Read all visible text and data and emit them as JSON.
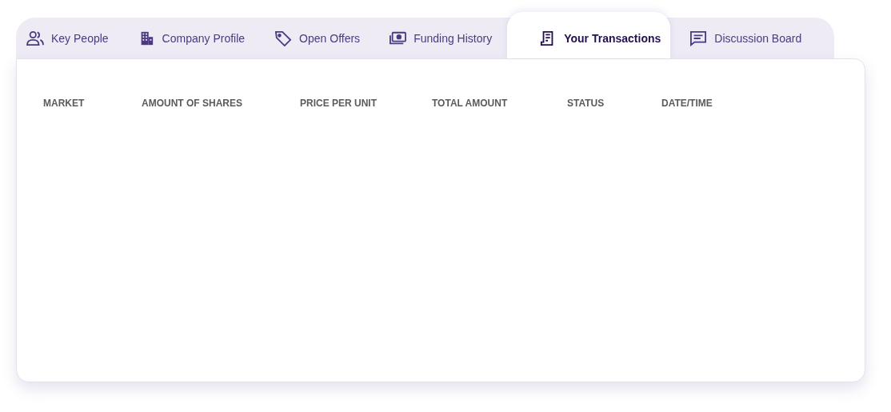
{
  "tabs": [
    {
      "label": "Key People",
      "selected": false
    },
    {
      "label": "Company Profile",
      "selected": false
    },
    {
      "label": "Open Offers",
      "selected": false
    },
    {
      "label": "Funding History",
      "selected": false
    },
    {
      "label": "Your Transactions",
      "selected": true
    },
    {
      "label": "Discussion Board",
      "selected": false
    }
  ],
  "table": {
    "columns": [
      "MARKET",
      "AMOUNT OF SHARES",
      "PRICE PER UNIT",
      "TOTAL AMOUNT",
      "STATUS",
      "DATE/TIME"
    ]
  }
}
